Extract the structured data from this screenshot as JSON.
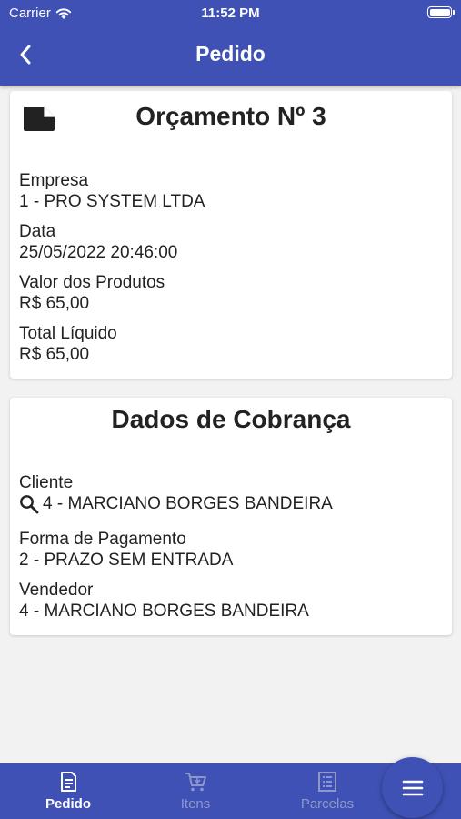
{
  "status_bar": {
    "carrier": "Carrier",
    "time": "11:52 PM"
  },
  "app_bar": {
    "title": "Pedido",
    "back_icon": "chevron-left-icon"
  },
  "order_card": {
    "icon": "document-icon",
    "title": "Orçamento Nº 3",
    "fields": [
      {
        "label": "Empresa",
        "value": "1 - PRO SYSTEM LTDA"
      },
      {
        "label": "Data",
        "value": "25/05/2022 20:46:00"
      },
      {
        "label": "Valor dos Produtos",
        "value": "R$ 65,00"
      },
      {
        "label": "Total Líquido",
        "value": "R$ 65,00"
      }
    ]
  },
  "billing_card": {
    "title": "Dados de Cobrança",
    "fields": [
      {
        "label": "Cliente",
        "value": "4 - MARCIANO BORGES BANDEIRA",
        "icon": "search-icon"
      },
      {
        "label": "Forma de Pagamento",
        "value": "2 - PRAZO SEM ENTRADA"
      },
      {
        "label": "Vendedor",
        "value": "4 - MARCIANO BORGES BANDEIRA"
      }
    ]
  },
  "bottom_nav": {
    "items": [
      {
        "label": "Pedido",
        "icon": "receipt-icon",
        "active": true
      },
      {
        "label": "Itens",
        "icon": "cart-icon",
        "active": false
      },
      {
        "label": "Parcelas",
        "icon": "list-icon",
        "active": false
      }
    ],
    "fab_icon": "menu-icon"
  },
  "colors": {
    "primary": "#3f51b5",
    "background": "#f2f2f2",
    "card": "#ffffff",
    "inactive_nav": "#8e97cc"
  }
}
